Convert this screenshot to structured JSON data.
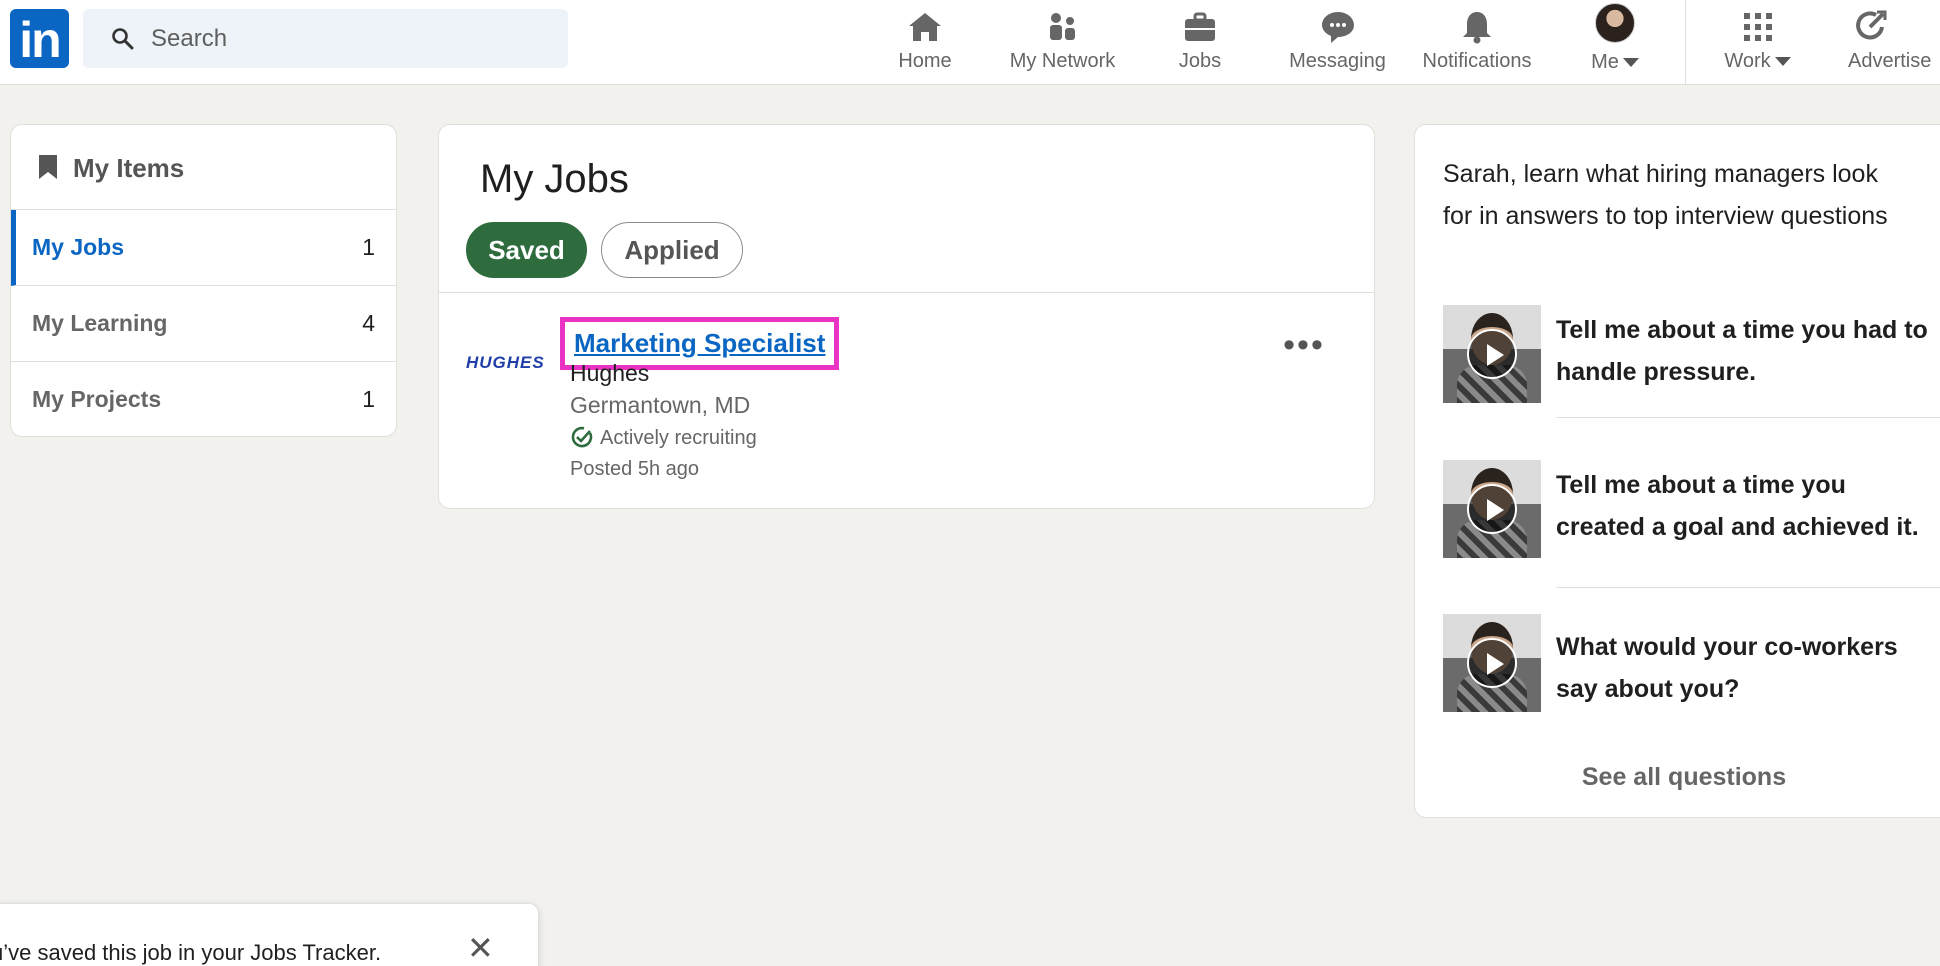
{
  "nav": {
    "logo": "in",
    "search_placeholder": "Search",
    "items": [
      {
        "label": "Home",
        "icon": "home-icon"
      },
      {
        "label": "My Network",
        "icon": "network-icon"
      },
      {
        "label": "Jobs",
        "icon": "briefcase-icon"
      },
      {
        "label": "Messaging",
        "icon": "messaging-icon"
      },
      {
        "label": "Notifications",
        "icon": "bell-icon"
      },
      {
        "label": "Me",
        "icon": "avatar"
      },
      {
        "label": "Work",
        "icon": "grid-icon"
      },
      {
        "label": "Advertise",
        "icon": "advertise-icon"
      }
    ]
  },
  "sidebar": {
    "title": "My Items",
    "items": [
      {
        "label": "My Jobs",
        "count": "1"
      },
      {
        "label": "My Learning",
        "count": "4"
      },
      {
        "label": "My Projects",
        "count": "1"
      }
    ]
  },
  "main": {
    "title": "My Jobs",
    "tabs": {
      "saved": "Saved",
      "applied": "Applied"
    },
    "job": {
      "logo_text": "HUGHES",
      "title": "Marketing Specialist",
      "company": "Hughes",
      "location": "Germantown, MD",
      "status": "Actively recruiting",
      "posted": "Posted 5h ago",
      "more": "•••"
    }
  },
  "aside": {
    "intro": "Sarah, learn what hiring managers look for in answers to top interview questions",
    "questions": [
      "Tell me about a time you had to handle pressure.",
      "Tell me about a time you created a goal and achieved it.",
      "What would your co-workers say about you?"
    ],
    "see_all": "See all questions"
  },
  "toast": {
    "message": "u’ve saved this job in your Jobs Tracker.",
    "close": "✕"
  },
  "colors": {
    "brand": "#0a66c2",
    "saved_pill": "#2e6c3e",
    "highlight": "#ea33c5"
  }
}
